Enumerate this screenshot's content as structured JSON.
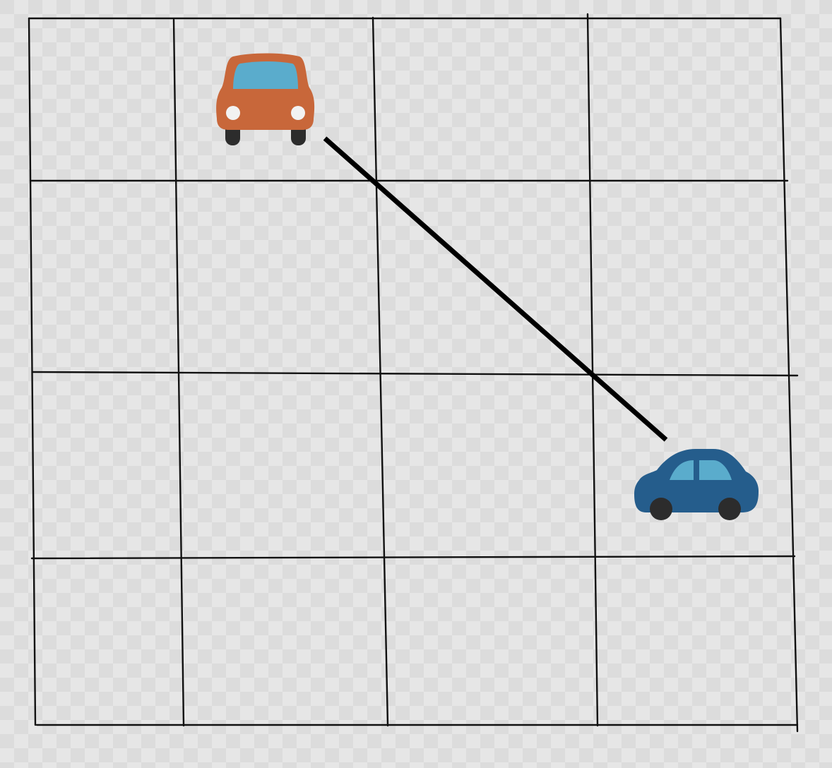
{
  "diagram": {
    "grid": {
      "rows": 4,
      "columns": 4,
      "line_color": "#111111"
    },
    "vehicles": [
      {
        "name": "orange-car-front-view",
        "body_color": "#c8673a",
        "window_color": "#5aaccc",
        "cell": {
          "row": 1,
          "col": 2
        }
      },
      {
        "name": "blue-car-side-view",
        "body_color": "#255d8c",
        "window_color": "#5aaccc",
        "cell": {
          "row": 3,
          "col": 4
        }
      }
    ],
    "connector": {
      "from": "orange-car-front-view",
      "to": "blue-car-side-view",
      "color": "#000000"
    }
  }
}
